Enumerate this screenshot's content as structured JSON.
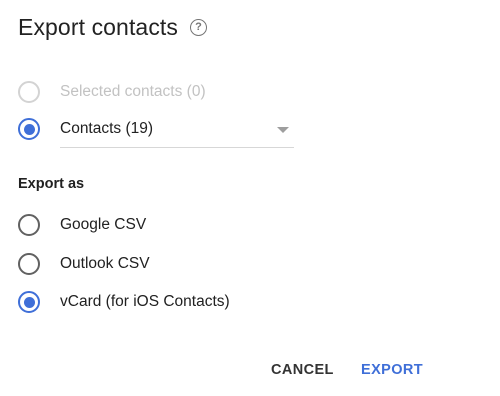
{
  "dialog": {
    "title": "Export contacts",
    "help_icon": "?"
  },
  "scope_options": [
    {
      "label": "Selected contacts (0)",
      "state": "disabled"
    },
    {
      "label": "Contacts (19)",
      "state": "checked"
    }
  ],
  "export_as": {
    "heading": "Export as",
    "options": [
      {
        "label": "Google CSV",
        "state": "unchecked"
      },
      {
        "label": "Outlook CSV",
        "state": "unchecked"
      },
      {
        "label": "vCard (for iOS Contacts)",
        "state": "checked"
      }
    ]
  },
  "actions": {
    "cancel_label": "CANCEL",
    "export_label": "EXPORT"
  },
  "colors": {
    "accent": "#3f6fd8",
    "disabled": "#c2c2c2"
  }
}
